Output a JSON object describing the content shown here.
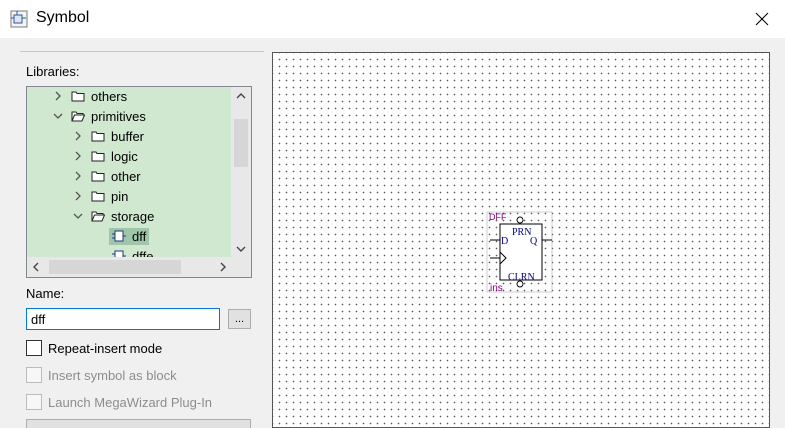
{
  "window": {
    "title": "Symbol",
    "icon": "symbol-window-icon",
    "close_icon": "close-icon"
  },
  "libraries": {
    "label": "Libraries:",
    "tree": [
      {
        "label": "others",
        "expanded": false,
        "kind": "folder",
        "level": 1
      },
      {
        "label": "primitives",
        "expanded": true,
        "kind": "folder",
        "level": 1
      },
      {
        "label": "buffer",
        "expanded": false,
        "kind": "folder",
        "level": 2
      },
      {
        "label": "logic",
        "expanded": false,
        "kind": "folder",
        "level": 2
      },
      {
        "label": "other",
        "expanded": false,
        "kind": "folder",
        "level": 2
      },
      {
        "label": "pin",
        "expanded": false,
        "kind": "folder",
        "level": 2
      },
      {
        "label": "storage",
        "expanded": true,
        "kind": "folder",
        "level": 2
      },
      {
        "label": "dff",
        "kind": "symbol",
        "level": 3,
        "selected": true
      },
      {
        "label": "dffe",
        "kind": "symbol",
        "level": 3
      }
    ],
    "tree_background": "#cfe8cf",
    "selected_background": "#9fc6a8"
  },
  "name_field": {
    "label": "Name:",
    "value": "dff",
    "browse_label": "..."
  },
  "options": {
    "repeat_insert": {
      "label": "Repeat-insert mode",
      "checked": false,
      "enabled": true
    },
    "insert_as_block": {
      "label": "Insert symbol as block",
      "checked": false,
      "enabled": false
    },
    "launch_megawizard": {
      "label": "Launch MegaWizard Plug-In",
      "checked": false,
      "enabled": false
    }
  },
  "preview": {
    "symbol_type": "DFF",
    "instance_name": "ins",
    "pins": {
      "preset": "PRN",
      "data": "D",
      "output": "Q",
      "clear": "CLRN"
    },
    "label_color": "#800080",
    "pin_text_color": "#000080"
  }
}
